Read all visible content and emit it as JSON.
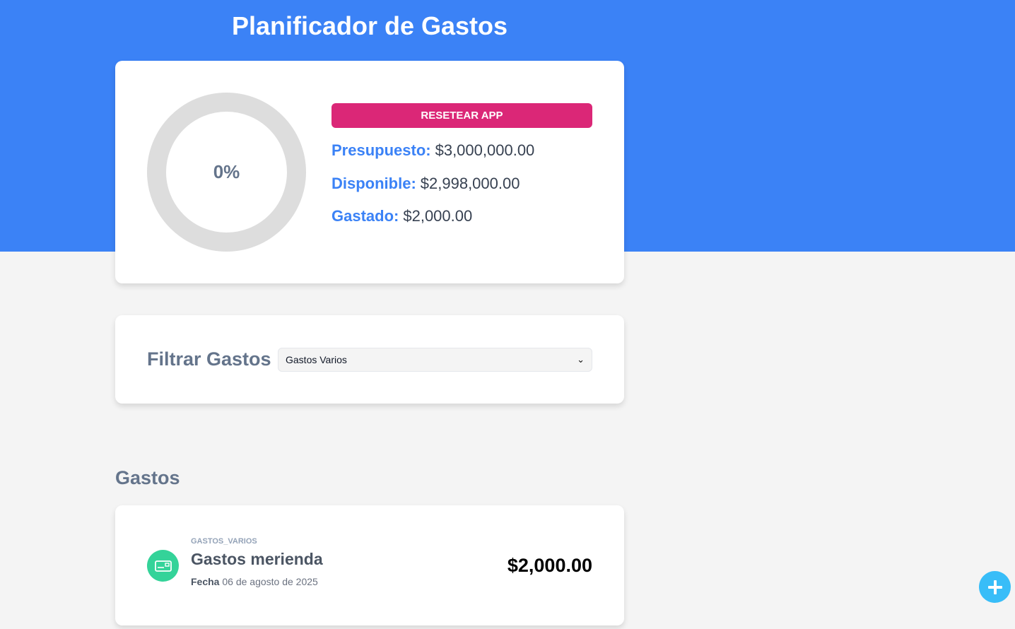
{
  "app": {
    "title": "Planificador de Gastos"
  },
  "budget": {
    "percent_label": "0%",
    "percent_value": 0,
    "reset_label": "RESETEAR APP",
    "presupuesto_label": "Presupuesto:",
    "presupuesto_value": "$3,000,000.00",
    "disponible_label": "Disponible:",
    "disponible_value": "$2,998,000.00",
    "gastado_label": "Gastado:",
    "gastado_value": "$2,000.00"
  },
  "filter": {
    "label": "Filtrar Gastos",
    "selected": "Gastos Varios"
  },
  "expenses": {
    "title": "Gastos",
    "items": [
      {
        "category": "GASTOS_VARIOS",
        "name": "Gastos merienda",
        "date_label": "Fecha",
        "date_value": "06 de agosto de 2025",
        "amount": "$2,000.00",
        "icon": "wallet-icon"
      }
    ]
  },
  "colors": {
    "header_blue": "#3b82f6",
    "reset_pink": "#db2777",
    "icon_green": "#34d399",
    "add_button": "#38bdf8"
  }
}
